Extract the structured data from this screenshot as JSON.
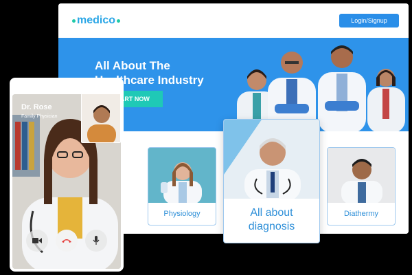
{
  "brand": {
    "name": "medico",
    "accent": "#2aa6e6",
    "dot_color": "#1fc9a8"
  },
  "header": {
    "login_label": "Login/Signup"
  },
  "hero": {
    "title_line1": "All About The",
    "title_line2": "Healthcare Industry",
    "cta_label": "START NOW",
    "background": "#2e93ea"
  },
  "cards": [
    {
      "label": "Physiology"
    },
    {
      "label": "All about diagnosis"
    },
    {
      "label": "Diathermy"
    }
  ],
  "call": {
    "name": "Dr. Rose",
    "role": "Family Physician",
    "buttons": [
      {
        "icon": "video-camera-icon"
      },
      {
        "icon": "end-call-icon"
      },
      {
        "icon": "microphone-icon"
      }
    ]
  }
}
